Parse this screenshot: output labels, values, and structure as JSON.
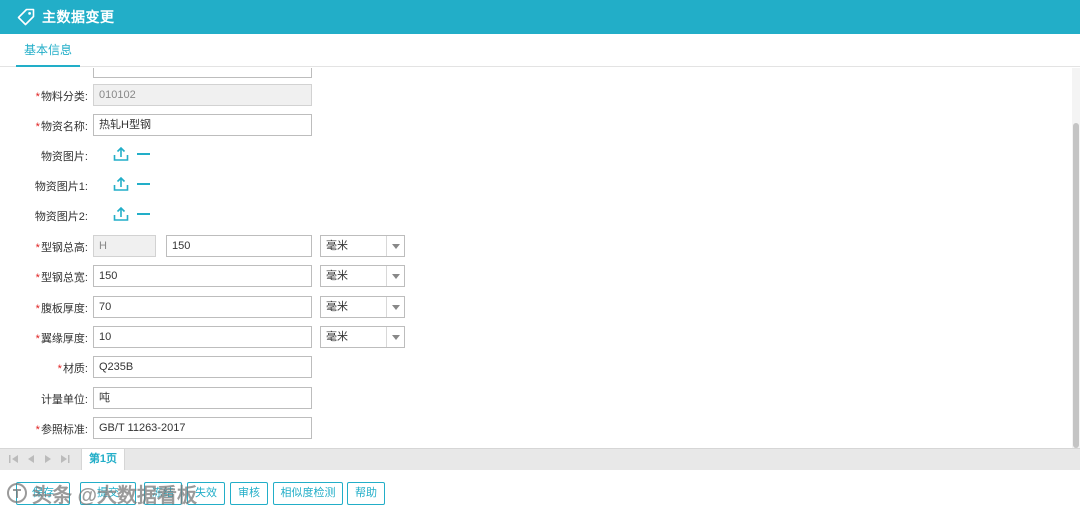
{
  "header": {
    "title": "主数据变更",
    "icon": "tag-icon"
  },
  "tabs": [
    {
      "label": "基本信息",
      "active": true
    }
  ],
  "form": {
    "fields": [
      {
        "label": "物料分类:",
        "required": true,
        "value": "010102",
        "disabled": true
      },
      {
        "label": "物资名称:",
        "required": true,
        "value": "热轧H型钢"
      },
      {
        "label": "物资图片:",
        "required": false,
        "type": "upload"
      },
      {
        "label": "物资图片1:",
        "required": false,
        "type": "upload"
      },
      {
        "label": "物资图片2:",
        "required": false,
        "type": "upload"
      },
      {
        "label": "型钢总高:",
        "required": true,
        "prefix": "H",
        "value": "150",
        "unit": "毫米"
      },
      {
        "label": "型钢总宽:",
        "required": true,
        "value": "150",
        "unit": "毫米"
      },
      {
        "label": "腹板厚度:",
        "required": true,
        "value": "70",
        "unit": "毫米"
      },
      {
        "label": "翼缘厚度:",
        "required": true,
        "value": "10",
        "unit": "毫米"
      },
      {
        "label": "材质:",
        "required": true,
        "value": "Q235B"
      },
      {
        "label": "计量单位:",
        "required": false,
        "value": "吨"
      },
      {
        "label": "参照标准:",
        "required": true,
        "value": "GB/T 11263-2017"
      }
    ]
  },
  "pager": {
    "page_label": "第1页"
  },
  "actions": {
    "buttons": [
      "保存",
      "提交",
      "冻结",
      "失效",
      "审核",
      "相似度检测",
      "帮助"
    ]
  },
  "watermark": {
    "text": "头条 @大数据看板"
  },
  "colors": {
    "accent": "#22aec8",
    "required": "#e02020"
  }
}
